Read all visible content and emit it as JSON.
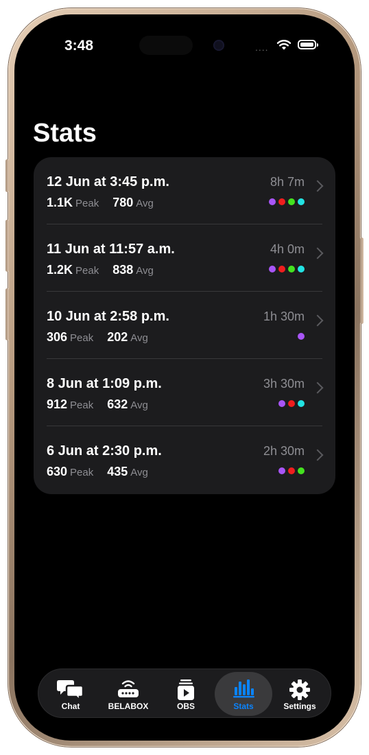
{
  "status_bar": {
    "time": "3:48",
    "signal": "....",
    "battery_full": true
  },
  "page": {
    "title": "Stats"
  },
  "sessions": [
    {
      "when": "12 Jun at 3:45 p.m.",
      "peak": "1.1K",
      "peak_label": "Peak",
      "avg": "780",
      "avg_label": "Avg",
      "duration": "8h 7m",
      "dots": [
        "#a855f7",
        "#ef1e1e",
        "#44e21f",
        "#22e3e3"
      ]
    },
    {
      "when": "11 Jun at 11:57 a.m.",
      "peak": "1.2K",
      "peak_label": "Peak",
      "avg": "838",
      "avg_label": "Avg",
      "duration": "4h 0m",
      "dots": [
        "#a855f7",
        "#ef1e1e",
        "#44e21f",
        "#22e3e3"
      ]
    },
    {
      "when": "10 Jun at 2:58 p.m.",
      "peak": "306",
      "peak_label": "Peak",
      "avg": "202",
      "avg_label": "Avg",
      "duration": "1h 30m",
      "dots": [
        "#a855f7"
      ]
    },
    {
      "when": "8 Jun at 1:09 p.m.",
      "peak": "912",
      "peak_label": "Peak",
      "avg": "632",
      "avg_label": "Avg",
      "duration": "3h 30m",
      "dots": [
        "#a855f7",
        "#ef1e1e",
        "#22e3e3"
      ]
    },
    {
      "when": "6 Jun at 2:30 p.m.",
      "peak": "630",
      "peak_label": "Peak",
      "avg": "435",
      "avg_label": "Avg",
      "duration": "2h 30m",
      "dots": [
        "#a855f7",
        "#ef1e1e",
        "#44e21f"
      ]
    }
  ],
  "tabbar": {
    "tabs": [
      {
        "label": "Chat",
        "icon": "chat-bubbles-icon",
        "active": false
      },
      {
        "label": "BELABOX",
        "icon": "router-icon",
        "active": false
      },
      {
        "label": "OBS",
        "icon": "play-stack-icon",
        "active": false
      },
      {
        "label": "Stats",
        "icon": "bar-chart-icon",
        "active": true
      },
      {
        "label": "Settings",
        "icon": "gear-icon",
        "active": false
      }
    ],
    "accent_color": "#0a84ff"
  }
}
